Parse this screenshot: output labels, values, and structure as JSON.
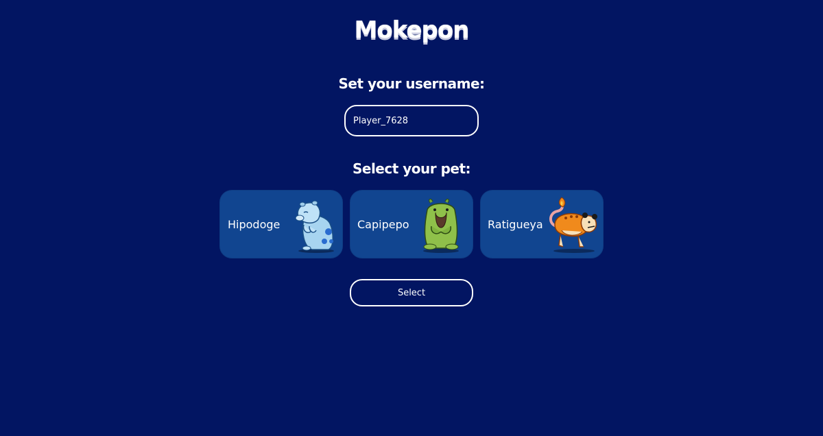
{
  "title": "Mokepon",
  "username": {
    "label": "Set your username:",
    "value": "Player_7628"
  },
  "pets": {
    "label": "Select your pet:",
    "items": [
      {
        "name": "Hipodoge",
        "icon": "hipodoge-icon"
      },
      {
        "name": "Capipepo",
        "icon": "capipepo-icon"
      },
      {
        "name": "Ratigueya",
        "icon": "ratigueya-icon"
      }
    ]
  },
  "select_button": "Select",
  "colors": {
    "background": "#021562",
    "card": "#114590",
    "text": "#ffffff"
  }
}
